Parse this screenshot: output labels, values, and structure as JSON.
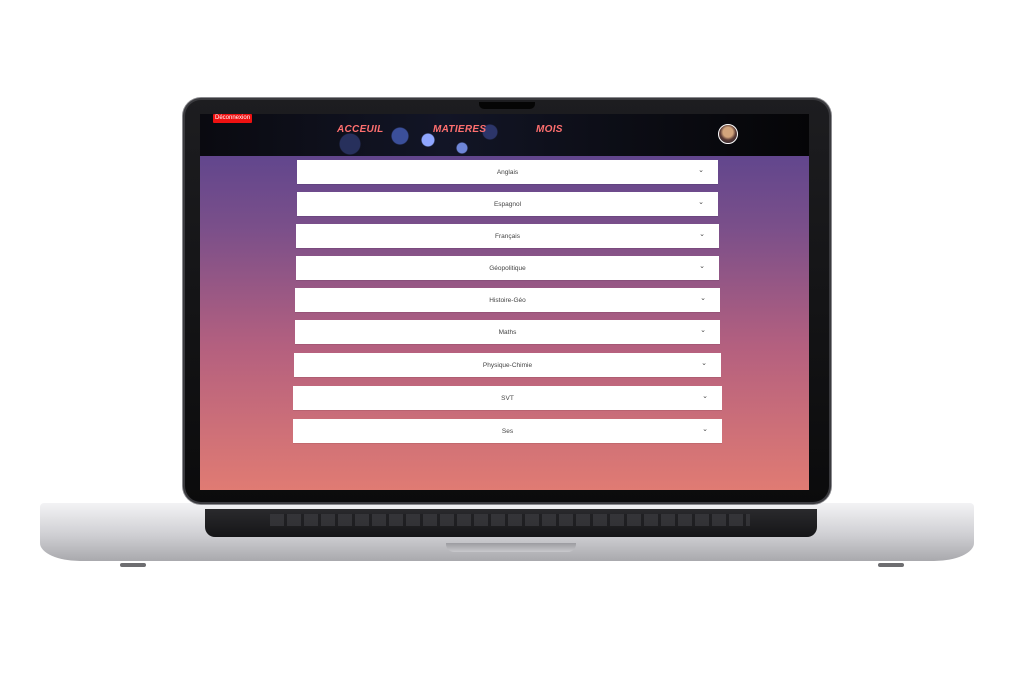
{
  "header": {
    "disconnect_label": "Déconnexion",
    "nav": {
      "accueil": "ACCEUIL",
      "matieres": "MATIERES",
      "mois": "MOIS"
    }
  },
  "subjects": [
    {
      "label": "Anglais"
    },
    {
      "label": "Espagnol"
    },
    {
      "label": "Français"
    },
    {
      "label": "Géopolitique"
    },
    {
      "label": "Histoire-Géo"
    },
    {
      "label": "Maths"
    },
    {
      "label": "Physique-Chimie"
    },
    {
      "label": "SVT"
    },
    {
      "label": "Ses"
    }
  ],
  "icons": {
    "expand": "chevron-down-icon"
  },
  "colors": {
    "disconnect_bg": "#ee1111",
    "nav_text": "#ff6f6f",
    "gradient_top": "#53418f",
    "gradient_bottom": "#e07b73"
  }
}
